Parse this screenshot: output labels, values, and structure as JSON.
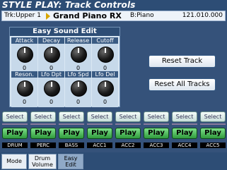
{
  "header": {
    "title": "STYLE PLAY: Track Controls"
  },
  "track_bar": {
    "track": "Trk:Upper 1",
    "sound": "Grand Piano RX",
    "bank": "B:Piano",
    "program": "121.010.000"
  },
  "easy_sound_edit": {
    "title": "Easy Sound Edit",
    "knobs": [
      {
        "label": "Attack",
        "value": "0"
      },
      {
        "label": "Decay",
        "value": "0"
      },
      {
        "label": "Release",
        "value": "0"
      },
      {
        "label": "Cutoff",
        "value": "0"
      },
      {
        "label": "Reson.",
        "value": "0"
      },
      {
        "label": "Lfo Dpt",
        "value": "0"
      },
      {
        "label": "Lfo Spd",
        "value": "0"
      },
      {
        "label": "Lfo Del",
        "value": "0"
      }
    ]
  },
  "buttons": {
    "reset_track": "Reset Track",
    "reset_all_tracks": "Reset All Tracks"
  },
  "tracks": [
    {
      "name": "DRUM",
      "select": "Select",
      "play": "Play"
    },
    {
      "name": "PERC",
      "select": "Select",
      "play": "Play"
    },
    {
      "name": "BASS",
      "select": "Select",
      "play": "Play"
    },
    {
      "name": "ACC1",
      "select": "Select",
      "play": "Play"
    },
    {
      "name": "ACC2",
      "select": "Select",
      "play": "Play"
    },
    {
      "name": "ACC3",
      "select": "Select",
      "play": "Play"
    },
    {
      "name": "ACC4",
      "select": "Select",
      "play": "Play"
    },
    {
      "name": "ACC5",
      "select": "Select",
      "play": "Play"
    }
  ],
  "tabs": [
    {
      "label": "Mode",
      "active": false
    },
    {
      "label": "Drum Volume",
      "active": false
    },
    {
      "label": "Easy Edit",
      "active": true
    }
  ],
  "colors": {
    "background": "#35527a",
    "title_bar": "#2d4d75",
    "play_green": "#3fb04e",
    "arrow": "#d8a600"
  }
}
